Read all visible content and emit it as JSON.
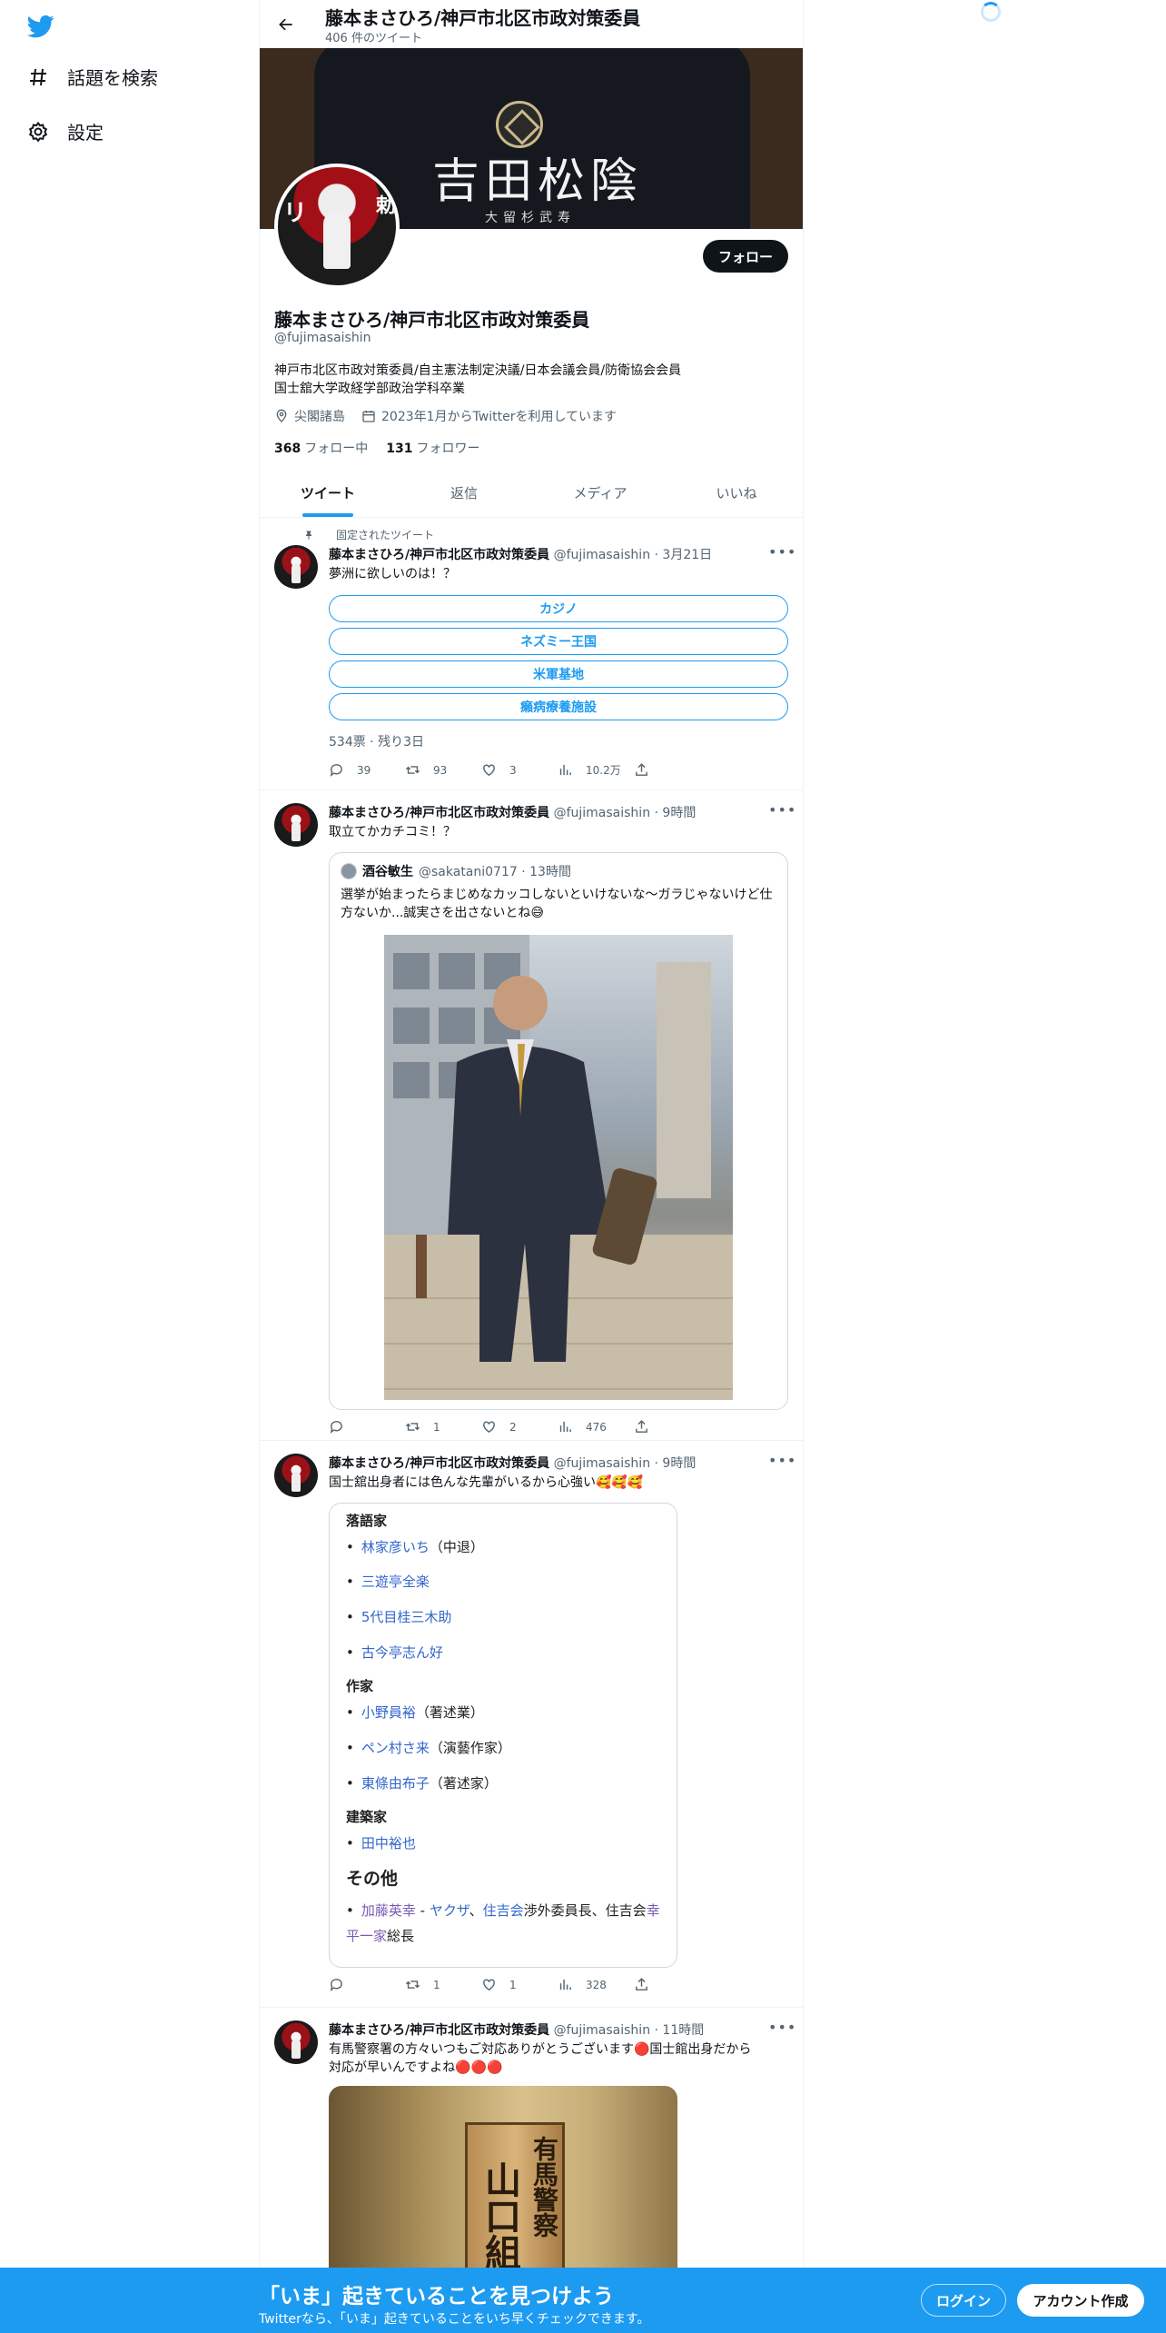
{
  "nav": {
    "explore_label": "話題を検索",
    "settings_label": "設定"
  },
  "header": {
    "title": "藤本まさひろ/神戸市北区市政対策委員",
    "subtitle": "406 件のツイート"
  },
  "banner": {
    "text": "吉田松陰",
    "small_text": "大留杉武寿"
  },
  "profile": {
    "follow_label": "フォロー",
    "name": "藤本まさひろ/神戸市北区市政対策委員",
    "handle": "@fujimasaishin",
    "bio_line1": "神戸市北区市政対策委員/自主憲法制定決議/日本会議会員/防衛協会会員",
    "bio_line2": "国士舘大学政経学部政治学科卒業",
    "location": "尖閣諸島",
    "joined": "2023年1月からTwitterを利用しています",
    "following_count": "368",
    "following_label": "フォロー中",
    "followers_count": "131",
    "followers_label": "フォロワー"
  },
  "tabs": [
    {
      "label": "ツイート",
      "active": true
    },
    {
      "label": "返信",
      "active": false
    },
    {
      "label": "メディア",
      "active": false
    },
    {
      "label": "いいね",
      "active": false
    }
  ],
  "tweets": [
    {
      "pinned_label": "固定されたツイート",
      "name": "藤本まさひろ/神戸市北区市政対策委員",
      "handle_time": "@fujimasaishin · 3月21日",
      "text": "夢洲に欲しいのは！？",
      "poll_options": [
        "カジノ",
        "ネズミー王国",
        "米軍基地",
        "癩病療養施設"
      ],
      "poll_meta": "534票 · 残り3日",
      "replies": "39",
      "retweets": "93",
      "likes": "3",
      "views": "10.2万"
    },
    {
      "name": "藤本まさひろ/神戸市北区市政対策委員",
      "handle_time": "@fujimasaishin · 9時間",
      "text": "取立てかカチコミ！？",
      "quote": {
        "name": "酒谷敏生",
        "handle_time": "@sakatani0717 · 13時間",
        "text": "選挙が始まったらまじめなカッコしないといけないな〜ガラじゃないけど仕方ないか...誠実さを出さないとね😅"
      },
      "replies": "",
      "retweets": "1",
      "likes": "2",
      "views": "476"
    },
    {
      "name": "藤本まさひろ/神戸市北区市政対策委員",
      "handle_time": "@fujimasaishin · 9時間",
      "text": "国士舘出身者には色んな先輩がいるから心強い🥰🥰🥰",
      "card": {
        "sec1": "落語家",
        "rakugo": [
          {
            "link": "林家彦いち",
            "rest": "（中退）"
          },
          {
            "link": "三遊亭全楽",
            "rest": ""
          },
          {
            "link": "5代目桂三木助",
            "rest": ""
          },
          {
            "link": "古今亭志ん好",
            "rest": ""
          }
        ],
        "sec2": "作家",
        "sakka": [
          {
            "link": "小野員裕",
            "rest": "（著述業）"
          },
          {
            "link": "ペン村さ来",
            "rest": "（演藝作家）"
          },
          {
            "link": "東條由布子",
            "rest": "（著述家）"
          }
        ],
        "sec3": "建築家",
        "kenchiku": [
          {
            "link": "田中裕也",
            "rest": ""
          }
        ],
        "sec4": "その他",
        "other_link1": "加藤英幸",
        "other_sep1": " - ",
        "other_link2": "ヤクザ",
        "other_sep2": "、",
        "other_link3": "住吉会",
        "other_mid": "渉外委員長、住吉会",
        "other_link4": "幸平一家",
        "other_end": "総長"
      },
      "replies": "",
      "retweets": "1",
      "likes": "1",
      "views": "328"
    },
    {
      "name": "藤本まさひろ/神戸市北区市政対策委員",
      "handle_time": "@fujimasaishin · 11時間",
      "text_line1": "有馬警察署の方々いつもご対応ありがとうございます🔴国士館出身だから",
      "text_line2": "対応が早いんですよね🔴🔴🔴",
      "photo_text1": "山口組",
      "photo_text2": "有馬警察"
    }
  ],
  "bottom_bar": {
    "title": "「いま」起きていることを見つけよう",
    "subtitle": "Twitterなら、「いま」起きていることをいち早くチェックできます。",
    "login_label": "ログイン",
    "signup_label": "アカウント作成"
  },
  "colors": {
    "accent": "#1d9bf0",
    "text": "#0f1419",
    "muted": "#536471"
  }
}
